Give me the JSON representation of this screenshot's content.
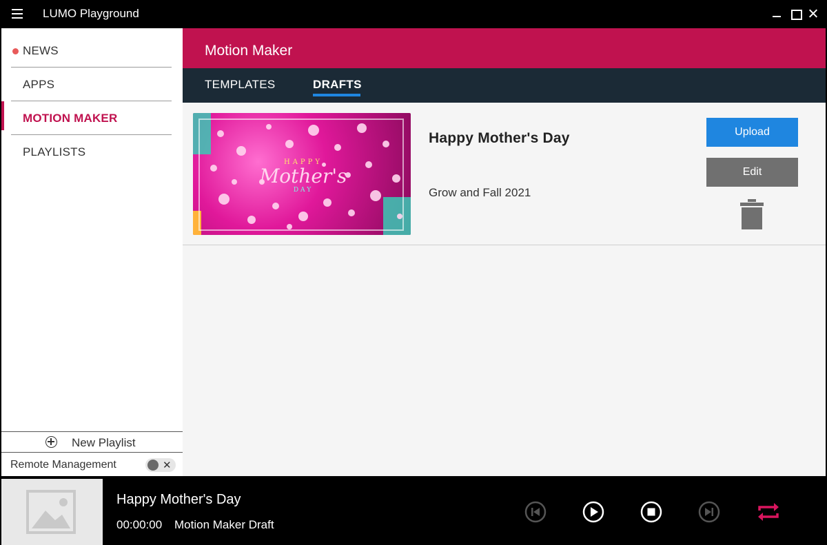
{
  "app": {
    "title": "LUMO Playground"
  },
  "sidebar": {
    "items": [
      {
        "label": "NEWS",
        "has_dot": true
      },
      {
        "label": "APPS"
      },
      {
        "label": "MOTION MAKER",
        "active": true
      },
      {
        "label": "PLAYLISTS"
      }
    ],
    "new_playlist_label": "New Playlist",
    "remote_management_label": "Remote Management",
    "remote_toggle_close": "✕"
  },
  "main": {
    "header_title": "Motion Maker",
    "tabs": [
      {
        "label": "TEMPLATES",
        "active": false
      },
      {
        "label": "DRAFTS",
        "active": true
      }
    ],
    "drafts": [
      {
        "title": "Happy Mother's Day",
        "subtitle": "Grow and Fall 2021",
        "thumbnail_text": [
          "HAPPY",
          "Mother's",
          "DAY"
        ],
        "upload_label": "Upload",
        "edit_label": "Edit"
      }
    ]
  },
  "player": {
    "title": "Happy Mother's Day",
    "time": "00:00:00",
    "source": "Motion Maker Draft",
    "icons": [
      "skip-previous-icon",
      "play-icon",
      "stop-icon",
      "skip-next-icon",
      "repeat-icon"
    ]
  },
  "colors": {
    "accent": "#c0124f",
    "tab_bar": "#1b2a36",
    "upload": "#1f86e0",
    "edit": "#707070"
  }
}
